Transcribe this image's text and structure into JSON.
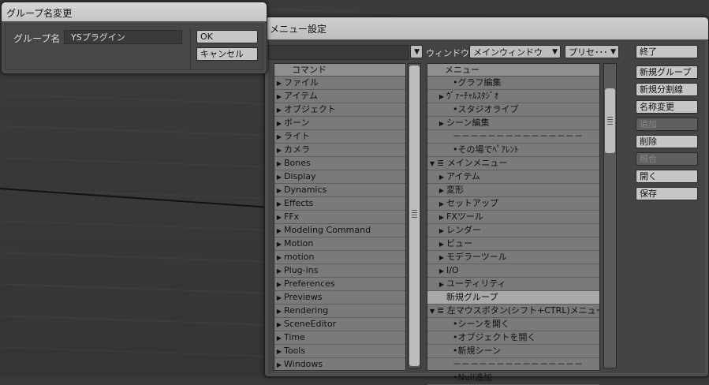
{
  "dialog": {
    "title": "グループ名変更",
    "label": "グループ名",
    "value": "YSプラグイン",
    "ok": "OK",
    "cancel": "キャンセル"
  },
  "menu_window": {
    "title": "メニュー設定",
    "window_label": "ウィンドウ",
    "window_select": "メインウィンドウ",
    "preset_select": "プリセ･･･"
  },
  "commands": {
    "header": "コマンド",
    "items": [
      "ファイル",
      "アイテム",
      "オブジェクト",
      "ボーン",
      "ライト",
      "カメラ",
      "Bones",
      "Display",
      "Dynamics",
      "Effects",
      "FFx",
      "Modeling Command",
      "Motion",
      "motion",
      "Plug-ins",
      "Preferences",
      "Previews",
      "Rendering",
      "SceneEditor",
      "Time",
      "Tools",
      "Windows"
    ]
  },
  "menus": {
    "header": "メニュー",
    "rows": [
      {
        "text": "•グラフ編集",
        "marker": "",
        "indent": 2
      },
      {
        "text": "ｳﾞｧｰﾁｬﾙｽﾀｼﾞｵ",
        "marker": "▶",
        "indent": 1
      },
      {
        "text": "•スタジオライブ",
        "marker": "",
        "indent": 2
      },
      {
        "text": "シーン編集",
        "marker": "▶",
        "indent": 1
      },
      {
        "text": "－－－－－－－－－－－－－－－",
        "marker": "",
        "indent": 2
      },
      {
        "text": "•その場でﾍﾟｱﾚﾝﾄ",
        "marker": "",
        "indent": 2
      },
      {
        "text": "≣ メインメニュー",
        "marker": "▼",
        "indent": 0
      },
      {
        "text": "アイテム",
        "marker": "▶",
        "indent": 1
      },
      {
        "text": "変形",
        "marker": "▶",
        "indent": 1
      },
      {
        "text": "セットアップ",
        "marker": "▶",
        "indent": 1
      },
      {
        "text": "FXツール",
        "marker": "▶",
        "indent": 1
      },
      {
        "text": "レンダー",
        "marker": "▶",
        "indent": 1
      },
      {
        "text": "ビュー",
        "marker": "▶",
        "indent": 1
      },
      {
        "text": "モデラーツール",
        "marker": "▶",
        "indent": 1
      },
      {
        "text": "I/O",
        "marker": "▶",
        "indent": 1
      },
      {
        "text": "ユーティリティ",
        "marker": "▶",
        "indent": 1
      },
      {
        "text": "新規グループ",
        "marker": "",
        "indent": 1,
        "selected": true
      },
      {
        "text": "≣ 左マウスボタン(シフト+CTRL)メニュー",
        "marker": "▼",
        "indent": 0
      },
      {
        "text": "•シーンを開く",
        "marker": "",
        "indent": 2
      },
      {
        "text": "•オブジェクトを開く",
        "marker": "",
        "indent": 2
      },
      {
        "text": "•新規シーン",
        "marker": "",
        "indent": 2
      },
      {
        "text": "－－－－－－－－－－－－－－－",
        "marker": "",
        "indent": 2
      },
      {
        "text": "•Null追加",
        "marker": "",
        "indent": 2
      }
    ]
  },
  "side_buttons": [
    {
      "label": "終了",
      "enabled": true
    },
    {
      "label": "新規グループ",
      "enabled": true
    },
    {
      "label": "新規分割線",
      "enabled": true
    },
    {
      "label": "名称変更",
      "enabled": true
    },
    {
      "label": "追加",
      "enabled": false
    },
    {
      "label": "削除",
      "enabled": true
    },
    {
      "label": "照合",
      "enabled": false
    },
    {
      "label": "開く",
      "enabled": true
    },
    {
      "label": "保存",
      "enabled": true
    }
  ]
}
